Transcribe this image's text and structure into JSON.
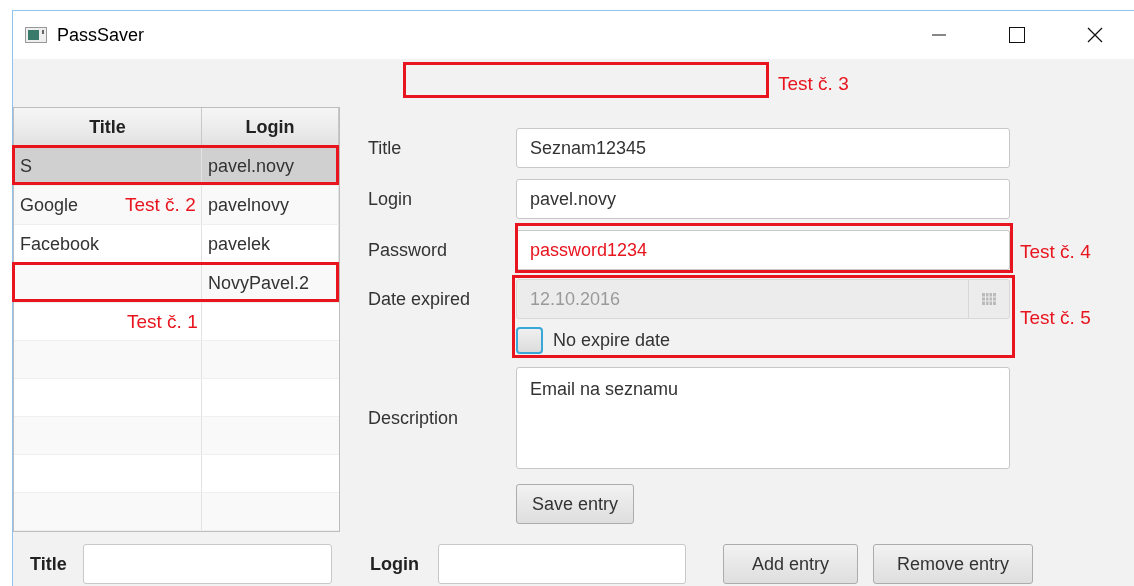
{
  "window": {
    "title": "PassSaver"
  },
  "table": {
    "columns": [
      "Title",
      "Login"
    ],
    "rows": [
      {
        "cells": [
          "S",
          "pavel.novy"
        ],
        "selected": true
      },
      {
        "cells": [
          "Google",
          "pavelnovy"
        ],
        "selected": false
      },
      {
        "cells": [
          "Facebook",
          "pavelek"
        ],
        "selected": false
      },
      {
        "cells": [
          "",
          "NovyPavel.2"
        ],
        "selected": false
      }
    ]
  },
  "form": {
    "fields": [
      {
        "label": "Title",
        "value": "Seznam12345",
        "invalid": false
      },
      {
        "label": "Login",
        "value": "pavel.novy",
        "invalid": false
      },
      {
        "label": "Password",
        "value": "password1234",
        "invalid": true
      }
    ],
    "date": {
      "label": "Date expired",
      "value": "12.10.2016",
      "disabled": true
    },
    "checkbox": {
      "label": "No expire date",
      "checked": false
    },
    "description": {
      "label": "Description",
      "value": "Email na seznamu"
    },
    "save_button": "Save entry"
  },
  "bottom_bar": {
    "title_label": "Title",
    "login_label": "Login",
    "buttons": [
      "Add entry",
      "Remove entry"
    ]
  },
  "annotations": [
    {
      "label": "Test č. 1"
    },
    {
      "label": "Test č. 2"
    },
    {
      "label": "Test č. 3"
    },
    {
      "label": "Test č. 4"
    },
    {
      "label": "Test č. 5"
    }
  ]
}
